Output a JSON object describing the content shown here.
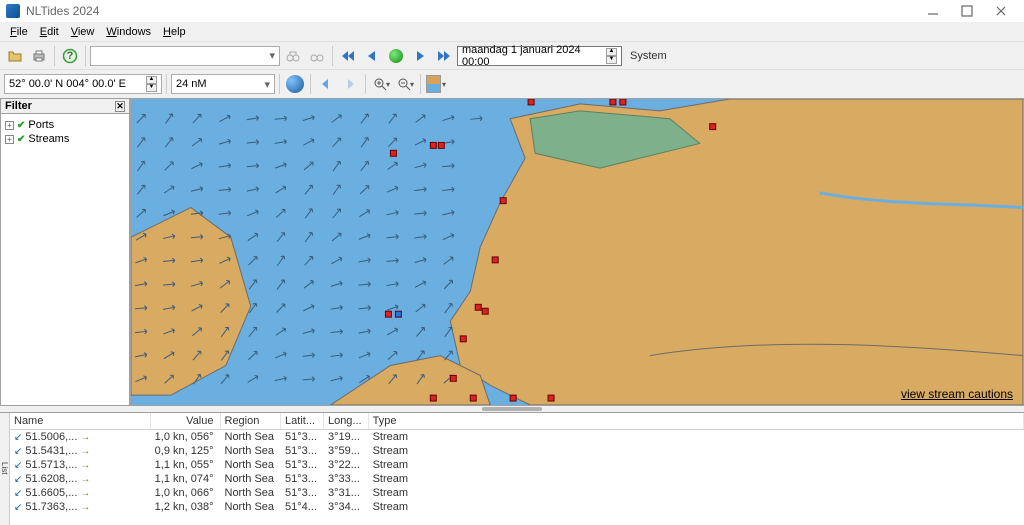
{
  "titlebar": {
    "title": "NLTides 2024"
  },
  "menu": {
    "file": "File",
    "edit": "Edit",
    "view": "View",
    "windows": "Windows",
    "help": "Help"
  },
  "toolbar1": {
    "search_placeholder": "",
    "search_value": "",
    "datetime": "maandag 1 januari 2024 00:00",
    "system_label": "System"
  },
  "toolbar2": {
    "coord_value": "52° 00.0' N 004° 00.0' E",
    "scale_value": "24 nM"
  },
  "filter": {
    "header": "Filter",
    "items": [
      {
        "label": "Ports"
      },
      {
        "label": "Streams"
      }
    ]
  },
  "map": {
    "caution_link": "view stream cautions"
  },
  "list": {
    "columns": {
      "name": "Name",
      "value": "Value",
      "region": "Region",
      "lat": "Latit...",
      "lon": "Long...",
      "type": "Type"
    },
    "rows": [
      {
        "name": "51.5006,...",
        "value": "1,0 kn, 056°",
        "region": "North Sea",
        "lat": "51°3...",
        "lon": "3°19...",
        "type": "Stream"
      },
      {
        "name": "51.5431,...",
        "value": "0,9 kn, 125°",
        "region": "North Sea",
        "lat": "51°3...",
        "lon": "3°59...",
        "type": "Stream"
      },
      {
        "name": "51.5713,...",
        "value": "1,1 kn, 055°",
        "region": "North Sea",
        "lat": "51°3...",
        "lon": "3°22...",
        "type": "Stream"
      },
      {
        "name": "51.6208,...",
        "value": "1,1 kn, 074°",
        "region": "North Sea",
        "lat": "51°3...",
        "lon": "3°33...",
        "type": "Stream"
      },
      {
        "name": "51.6605,...",
        "value": "1,0 kn, 066°",
        "region": "North Sea",
        "lat": "51°3...",
        "lon": "3°31...",
        "type": "Stream"
      },
      {
        "name": "51.7363,...",
        "value": "1,2 kn, 038°",
        "region": "North Sea",
        "lat": "51°4...",
        "lon": "3°34...",
        "type": "Stream"
      }
    ]
  }
}
